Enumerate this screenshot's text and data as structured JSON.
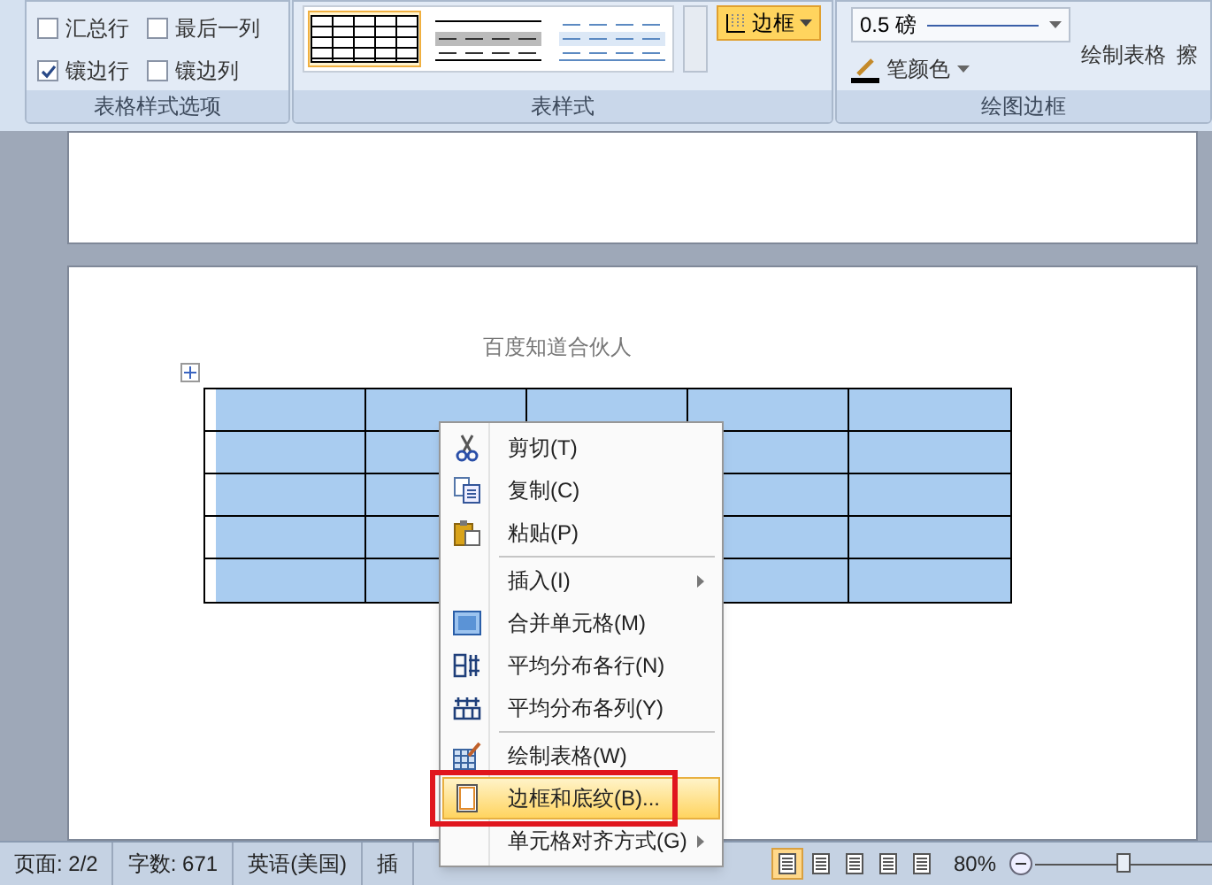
{
  "ribbon": {
    "groups": [
      {
        "kind": "options",
        "label": "表格样式选项",
        "checkboxes": [
          {
            "label": "汇总行",
            "checked": false
          },
          {
            "label": "最后一列",
            "checked": false
          },
          {
            "label": "镶边行",
            "checked": true
          },
          {
            "label": "镶边列",
            "checked": false
          }
        ]
      },
      {
        "kind": "styles",
        "label": "表样式",
        "styles": [
          {
            "selected": true
          },
          {
            "selected": false
          },
          {
            "selected": false
          }
        ],
        "border_button": {
          "label": "边框",
          "selected": true
        }
      },
      {
        "kind": "draw",
        "label": "绘图边框",
        "weight": "0.5 磅",
        "pen_color": "笔颜色",
        "buttons": [
          "绘制表格",
          "擦"
        ]
      }
    ]
  },
  "document": {
    "header": "百度知道合伙人",
    "table": {
      "selected": true
    }
  },
  "context_menu": {
    "items": [
      {
        "label": "剪切(T)",
        "submenu": false,
        "separator_before": false,
        "selected": false
      },
      {
        "label": "复制(C)",
        "submenu": false,
        "separator_before": false,
        "selected": false
      },
      {
        "label": "粘贴(P)",
        "submenu": false,
        "separator_before": false,
        "selected": false
      },
      {
        "label": "插入(I)",
        "submenu": true,
        "separator_before": true,
        "selected": false
      },
      {
        "label": "合并单元格(M)",
        "submenu": false,
        "separator_before": false,
        "selected": false
      },
      {
        "label": "平均分布各行(N)",
        "submenu": false,
        "separator_before": false,
        "selected": false
      },
      {
        "label": "平均分布各列(Y)",
        "submenu": false,
        "separator_before": false,
        "selected": false
      },
      {
        "label": "绘制表格(W)",
        "submenu": false,
        "separator_before": true,
        "selected": false
      },
      {
        "label": "边框和底纹(B)...",
        "submenu": false,
        "separator_before": false,
        "selected": true
      },
      {
        "label": "单元格对齐方式(G)",
        "submenu": true,
        "separator_before": false,
        "selected": false
      }
    ]
  },
  "status_bar": {
    "items": [
      "页面: 2/2",
      "字数: 671",
      "英语(美国)",
      "插"
    ],
    "views": [
      {
        "selected": true
      },
      {
        "selected": false
      },
      {
        "selected": false
      },
      {
        "selected": false
      },
      {
        "selected": false
      }
    ],
    "zoom": "80%",
    "zoom_slider": {
      "level": 0.5
    }
  }
}
